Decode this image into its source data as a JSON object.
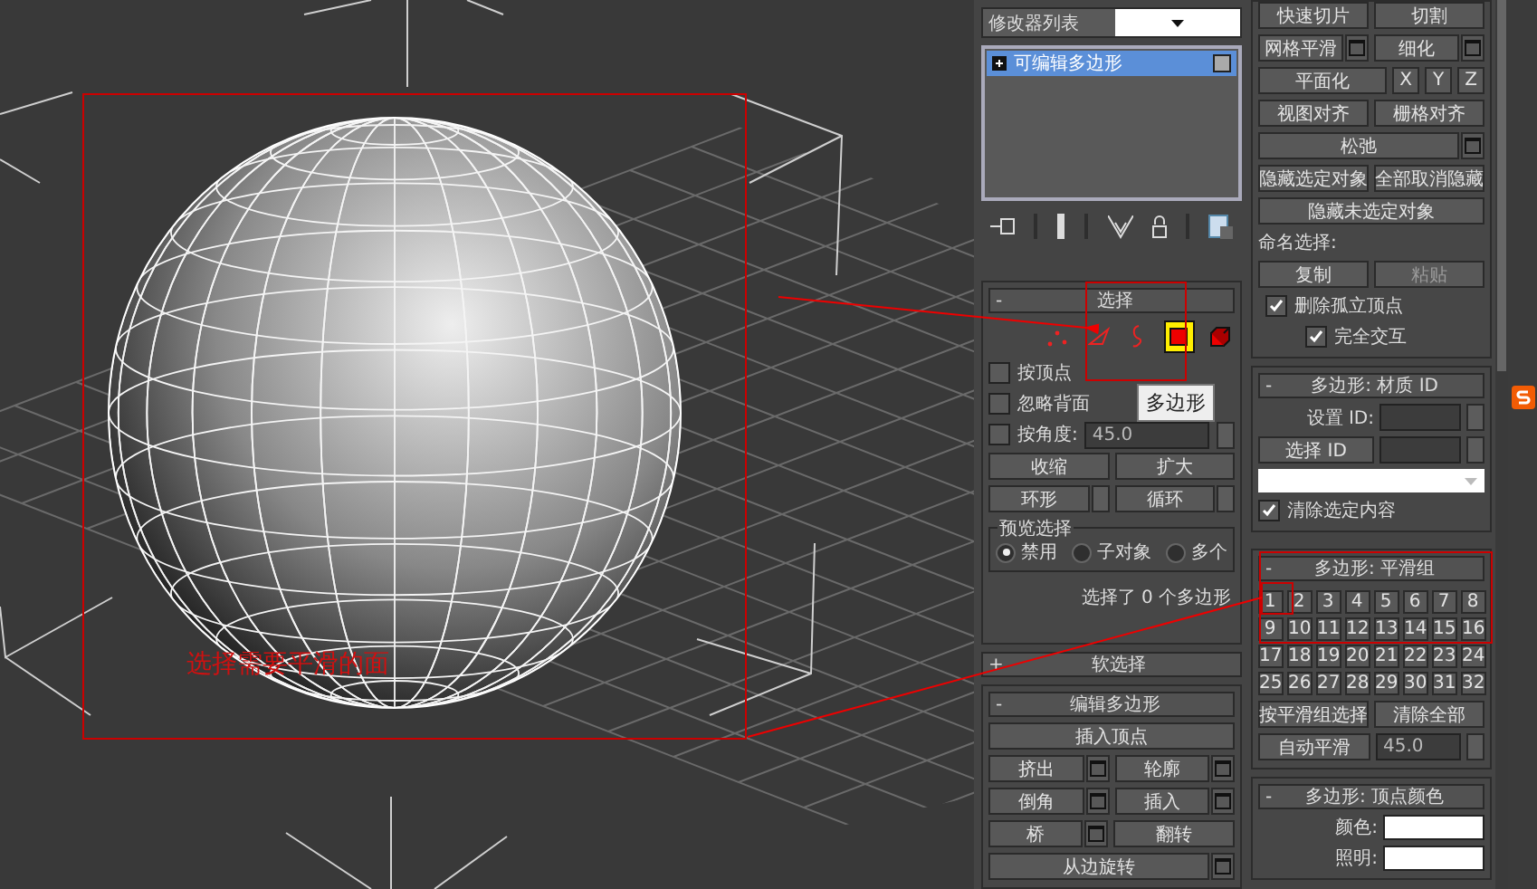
{
  "viewport": {
    "caption": "选择需要平滑的面"
  },
  "modifier_panel": {
    "dropdown": "修改器列表",
    "stack": [
      {
        "label": "可编辑多边形",
        "selected": true
      }
    ],
    "selection": {
      "sign": "-",
      "title": "选择",
      "subobjects": [
        {
          "kind": "vertex",
          "selected": false
        },
        {
          "kind": "edge",
          "selected": false
        },
        {
          "kind": "border",
          "selected": false
        },
        {
          "kind": "polygon",
          "selected": true
        },
        {
          "kind": "element",
          "selected": false
        }
      ],
      "tooltip": "多边形",
      "checks": [
        {
          "label": "按顶点",
          "checked": false
        },
        {
          "label": "忽略背面",
          "checked": false
        },
        {
          "label": "按角度:",
          "checked": false,
          "value": "45.0"
        }
      ],
      "button_rows": [
        [
          {
            "kind": "button",
            "label": "收缩"
          },
          {
            "kind": "button",
            "label": "扩大"
          }
        ],
        [
          {
            "kind": "spin",
            "label": "环形"
          },
          {
            "kind": "spin",
            "label": "循环"
          }
        ]
      ],
      "preview": {
        "title": "预览选择",
        "radios": [
          {
            "label": "禁用",
            "selected": true
          },
          {
            "label": "子对象",
            "selected": false
          },
          {
            "label": "多个",
            "selected": false
          }
        ]
      },
      "status": "选择了 0 个多边形"
    },
    "soft_selection": {
      "sign": "+",
      "title": "软选择"
    },
    "edit_polygons": {
      "sign": "-",
      "title": "编辑多边形",
      "button_rows": [
        [
          {
            "kind": "button",
            "label": "插入顶点"
          }
        ],
        [
          {
            "kind": "box",
            "label": "挤出"
          },
          {
            "kind": "box",
            "label": "轮廓"
          }
        ],
        [
          {
            "kind": "box",
            "label": "倒角"
          },
          {
            "kind": "box",
            "label": "插入"
          }
        ],
        [
          {
            "kind": "box",
            "label": "桥"
          },
          {
            "kind": "button",
            "label": "翻转"
          }
        ],
        [
          {
            "kind": "box",
            "label": "从边旋转"
          }
        ]
      ]
    }
  },
  "panel_right": {
    "button_rows": [
      [
        {
          "kind": "button",
          "label": "快速切片",
          "disabled": false
        },
        {
          "kind": "button",
          "label": "切割",
          "disabled": false
        }
      ],
      [
        {
          "kind": "box",
          "label": "网格平滑",
          "disabled": false
        },
        {
          "kind": "box",
          "label": "细化",
          "disabled": false
        }
      ],
      [
        {
          "kind": "button",
          "label": "平面化",
          "disabled": false
        },
        {
          "kind": "axis",
          "label": "X",
          "disabled": false
        },
        {
          "kind": "axis",
          "label": "Y",
          "disabled": false
        },
        {
          "kind": "axis",
          "label": "Z",
          "disabled": false
        }
      ],
      [
        {
          "kind": "button",
          "label": "视图对齐",
          "disabled": false
        },
        {
          "kind": "button",
          "label": "栅格对齐",
          "disabled": false
        }
      ],
      [
        {
          "kind": "box",
          "label": "松弛",
          "disabled": false
        }
      ],
      [
        {
          "kind": "button",
          "label": "隐藏选定对象",
          "disabled": false
        },
        {
          "kind": "button",
          "label": "全部取消隐藏",
          "disabled": false
        }
      ],
      [
        {
          "kind": "button",
          "label": "隐藏未选定对象",
          "disabled": false
        }
      ]
    ],
    "named_selection": "命名选择:",
    "named_buttons": [
      {
        "label": "复制",
        "disabled": false
      },
      {
        "label": "粘贴",
        "disabled": true
      }
    ],
    "checks": [
      {
        "label": "删除孤立顶点",
        "checked": true
      },
      {
        "label": "完全交互",
        "checked": true
      }
    ],
    "material": {
      "sign": "-",
      "title": "多边形: 材质 ID",
      "set_id": "设置 ID:",
      "select_id": "选择 ID",
      "clear": {
        "label": "清除选定内容",
        "checked": true
      }
    },
    "smoothing": {
      "sign": "-",
      "title": "多边形: 平滑组",
      "groups": [
        "1",
        "2",
        "3",
        "4",
        "5",
        "6",
        "7",
        "8",
        "9",
        "10",
        "11",
        "12",
        "13",
        "14",
        "15",
        "16",
        "17",
        "18",
        "19",
        "20",
        "21",
        "22",
        "23",
        "24",
        "25",
        "26",
        "27",
        "28",
        "29",
        "30",
        "31",
        "32"
      ],
      "select_by": "按平滑组选择",
      "clear_all": "清除全部",
      "auto_smooth": "自动平滑",
      "threshold": "45.0"
    },
    "vertex_colors": {
      "sign": "-",
      "title": "多边形: 顶点颜色",
      "fields": [
        "颜色:",
        "照明:"
      ]
    }
  }
}
